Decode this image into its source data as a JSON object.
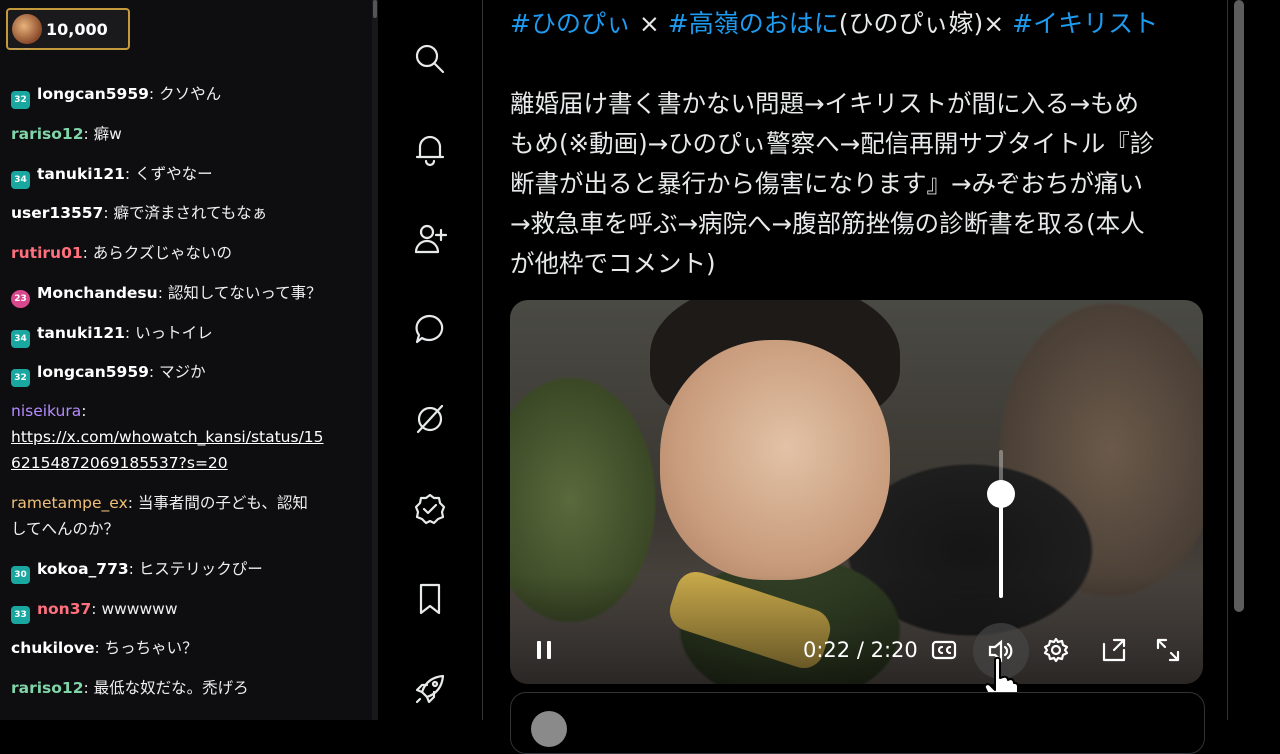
{
  "chat": {
    "points": "10,000",
    "partial_top": "– –",
    "messages": [
      {
        "badge": "32",
        "badge_color": "#19a7a0",
        "user": "longcan5959",
        "user_color": "#ffffff",
        "text": ": クソやん"
      },
      {
        "badge": "",
        "user": "rariso12",
        "user_color": "#7fd4a8",
        "text": ": 癖w"
      },
      {
        "badge": "34",
        "badge_color": "#19a7a0",
        "user": "tanuki121",
        "user_color": "#ffffff",
        "text": ": くずやなー"
      },
      {
        "badge": "",
        "user": "user13557",
        "user_color": "#ffffff",
        "text": ": 癖で済まされてもなぁ"
      },
      {
        "badge": "",
        "user": "rutiru01",
        "user_color": "#ff6f7d",
        "text": ": あらクズじゃないの"
      },
      {
        "badge": "23",
        "badge_color": "#d8488c",
        "user": "Monchandesu",
        "user_color": "#ffffff",
        "text": ": 認知してないって事？"
      },
      {
        "badge": "34",
        "badge_color": "#19a7a0",
        "user": "tanuki121",
        "user_color": "#ffffff",
        "text": ": いっトイレ"
      },
      {
        "badge": "32",
        "badge_color": "#19a7a0",
        "user": "longcan5959",
        "user_color": "#ffffff",
        "text": ": マジか"
      }
    ],
    "link_msg": {
      "user": "niseikura",
      "user_color": "#b58cff",
      "url_line1": "https://x.com/whowatch_kansi/status/15",
      "url_line2": "62154872069185537?s=20"
    },
    "wrap_msg": {
      "user": "rametampe_ex",
      "user_color": "#f0c078",
      "line1": ": 当事者間の子ども、認知",
      "line2": "してへんのか？"
    },
    "messages2": [
      {
        "badge": "30",
        "badge_color": "#19a7a0",
        "user": "kokoa_773",
        "user_color": "#ffffff",
        "text": ": ヒステリックぴー"
      },
      {
        "badge": "33",
        "badge_color": "#19a7a0",
        "user": "non37",
        "user_color": "#ff6f7d",
        "text": ": wwwwww"
      },
      {
        "badge": "",
        "user": "chukilove",
        "user_color": "#ffffff",
        "text": ": ちっちゃい？"
      },
      {
        "badge": "",
        "user": "rariso12",
        "user_color": "#7fd4a8",
        "text": ": 最低な奴だな。禿げろ"
      }
    ]
  },
  "nav_icons": [
    "search-icon",
    "bell-icon",
    "add-user-icon",
    "message-icon",
    "grok-slash-icon",
    "verified-icon",
    "bookmark-icon",
    "rocket-icon"
  ],
  "tweet": {
    "hash1": "#ひのぴぃ",
    "sep1": " × ",
    "hash2": "#高嶺のおはに",
    "mid": "(ひのぴぃ嫁)× ",
    "hash3": "#イキリスト",
    "lines": [
      "離婚届け書く書かない問題→イキリストが間に入る→もめ",
      "もめ(※動画)→ひのぴぃ警察へ→配信再開サブタイトル『診",
      "断書が出ると暴行から傷害になります』→みぞおちが痛い",
      "→救急車を呼ぶ→病院へ→腹部筋挫傷の診断書を取る(本人",
      "が他枠でコメント)"
    ]
  },
  "video": {
    "time": "0:22 / 2:20",
    "volume_level": 0.7
  }
}
